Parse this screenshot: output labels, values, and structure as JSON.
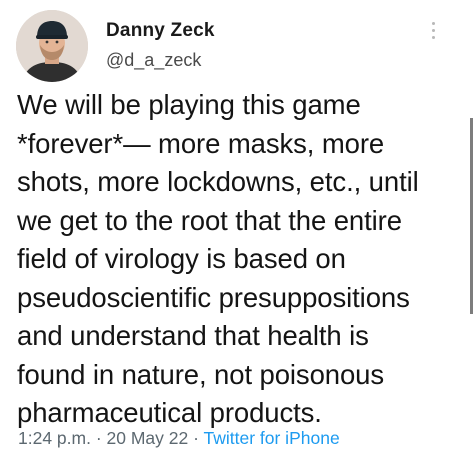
{
  "user": {
    "display_name": "Danny Zeck",
    "handle": "@d_a_zeck"
  },
  "tweet": {
    "text": "We will be playing this game\n*forever*— more masks, more\nshots, more lockdowns, etc., until\nwe get to the root that the entire\nfield of virology is based on\npseudoscientific presuppositions\nand understand that health is\nfound in nature, not poisonous\npharmaceutical products."
  },
  "meta": {
    "time": "1:24 p.m.",
    "separator_1": " · ",
    "date": "20 May 22",
    "separator_2": " · ",
    "source": "Twitter for iPhone"
  },
  "icons": {
    "menu": "more-vertical-icon",
    "avatar": "profile-photo"
  },
  "colors": {
    "link": "#1d9bf0",
    "text": "#141414",
    "muted": "#5c6870"
  }
}
